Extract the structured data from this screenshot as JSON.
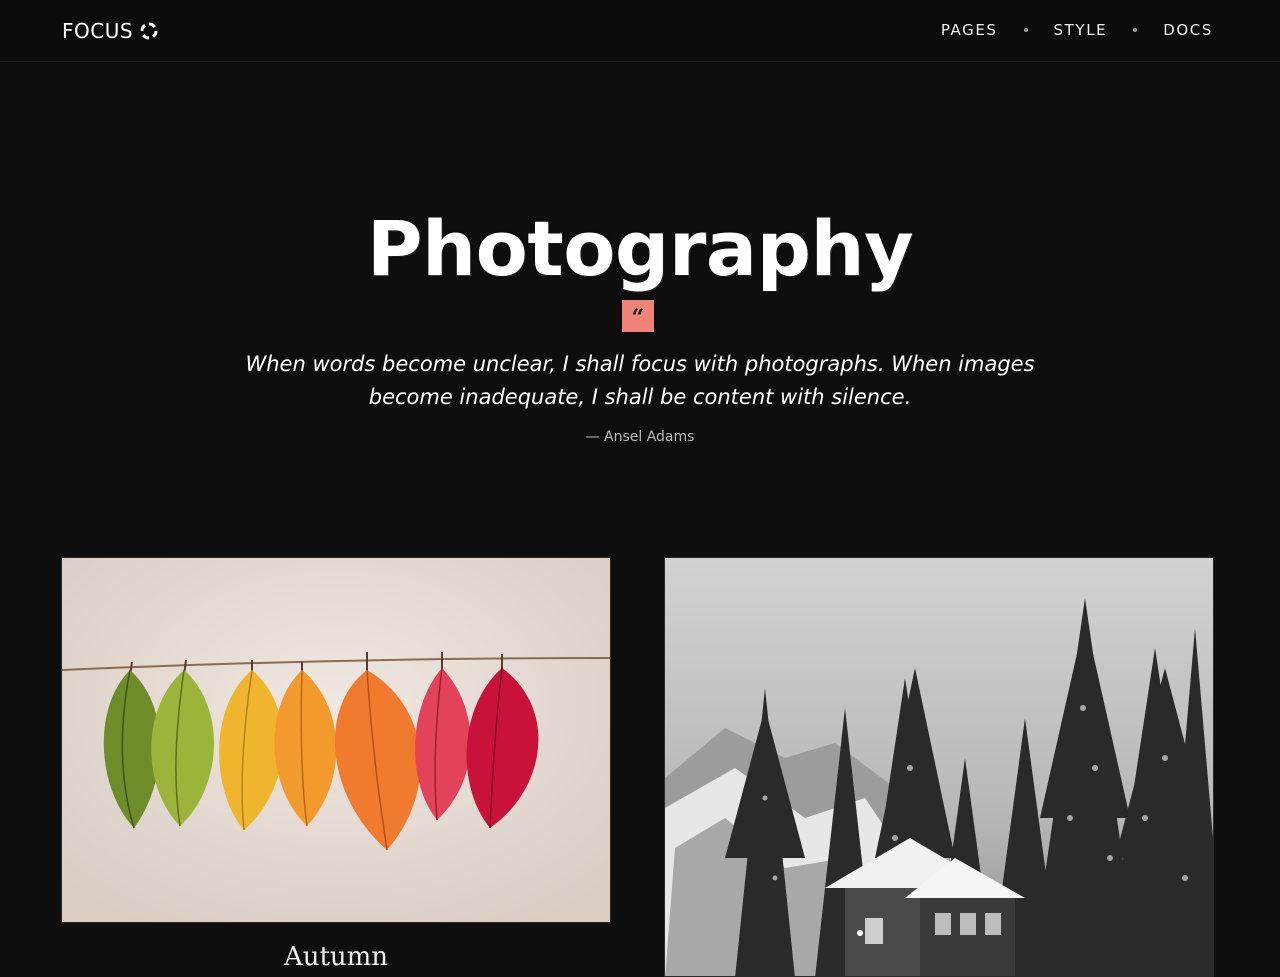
{
  "header": {
    "logo_text": "FOCUS",
    "nav": [
      {
        "label": "PAGES"
      },
      {
        "label": "STYLE"
      },
      {
        "label": "DOCS"
      }
    ]
  },
  "hero": {
    "title": "Photography",
    "quote_mark": "“",
    "quote": "When words become unclear, I shall focus with photographs. When images become inadequate, I shall be content with silence.",
    "author": "— Ansel Adams"
  },
  "gallery": [
    {
      "caption": "Autumn",
      "image": "hanging-autumn-leaves"
    },
    {
      "caption": "",
      "image": "snowy-cabin-forest"
    }
  ],
  "colors": {
    "background": "#0e0e0f",
    "accent": "#f0847a"
  }
}
